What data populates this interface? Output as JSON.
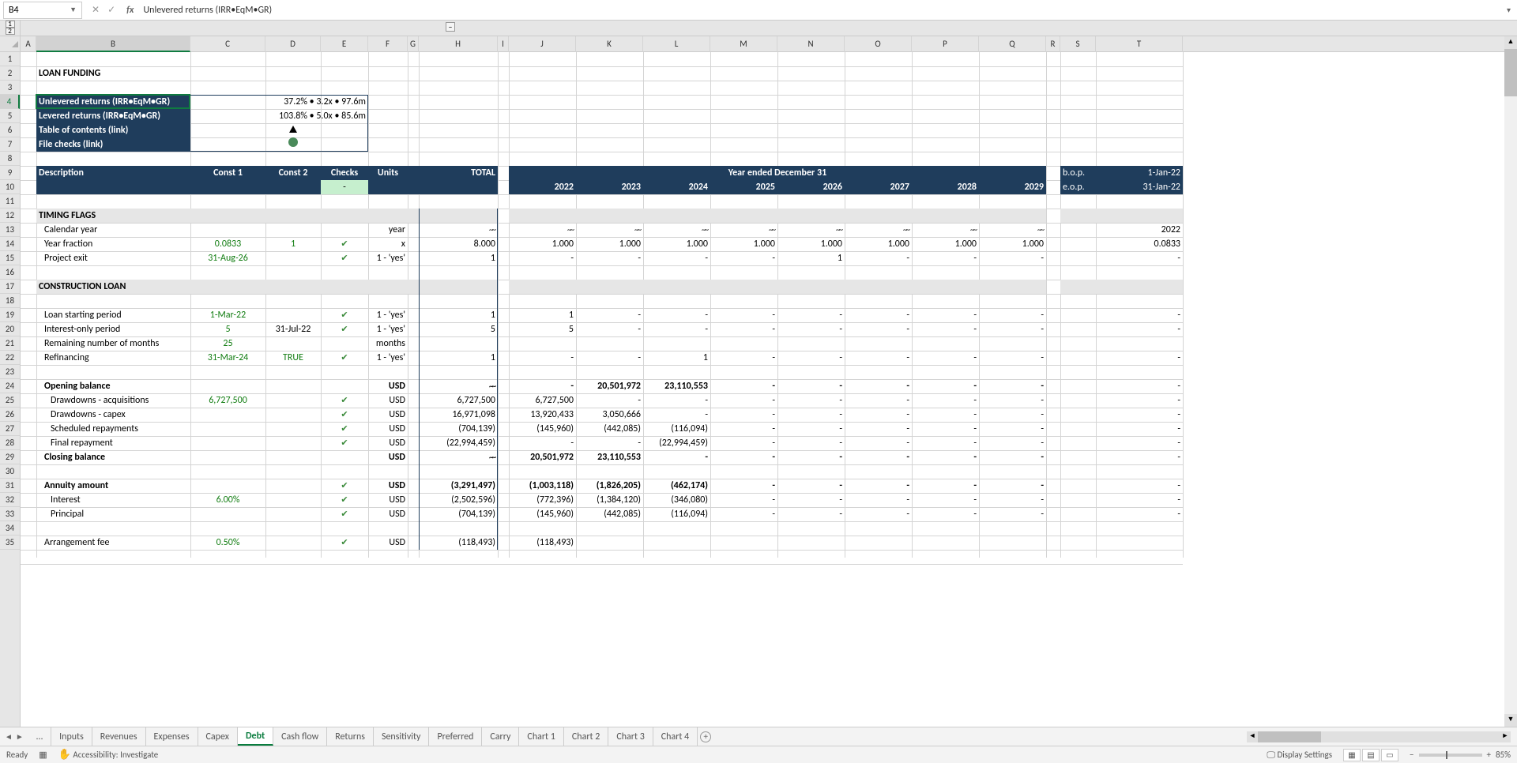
{
  "cellref": "B4",
  "formula": "Unlevered returns (IRR•EqM•GR)",
  "outline": {
    "lv1": "1",
    "lv2": "2",
    "minus": "–"
  },
  "cols": [
    "A",
    "B",
    "C",
    "D",
    "E",
    "F",
    "G",
    "H",
    "I",
    "J",
    "K",
    "L",
    "M",
    "N",
    "O",
    "P",
    "Q",
    "R",
    "S",
    "T"
  ],
  "rownums": [
    "1",
    "2",
    "3",
    "4",
    "5",
    "6",
    "7",
    "8",
    "9",
    "10",
    "11",
    "12",
    "13",
    "14",
    "15",
    "16",
    "17",
    "18",
    "19",
    "20",
    "21",
    "22",
    "23",
    "24",
    "25",
    "26",
    "27",
    "28",
    "29",
    "30",
    "31",
    "32",
    "33",
    "34",
    "35"
  ],
  "title": "LOAN FUNDING",
  "box": {
    "r4l": "Unlevered returns (IRR•EqM•GR)",
    "r4r": "37.2% • 3.2x • 97.6m",
    "r5l": "Levered returns (IRR•EqM•GR)",
    "r5r": "103.8% • 5.0x • 85.6m",
    "r6l": "Table of contents (link)",
    "r7l": "File checks (link)"
  },
  "hdr": {
    "desc": "Description",
    "c1": "Const 1",
    "c2": "Const 2",
    "chk": "Checks",
    "units": "Units",
    "total": "TOTAL",
    "yrs": "Year ended December 31",
    "bop": "b.o.p.",
    "bopv": "1-Jan-22",
    "eop": "e.o.p.",
    "eopv": "31-Jan-22",
    "y": [
      "2022",
      "2023",
      "2024",
      "2025",
      "2026",
      "2027",
      "2028",
      "2029"
    ],
    "dash": "-"
  },
  "s12": "TIMING FLAGS",
  "r13": {
    "b": "Calendar year",
    "f": "year",
    "h": "~~",
    "y": [
      "~~",
      "~~",
      "~~",
      "~~",
      "~~",
      "~~",
      "~~",
      "~~"
    ],
    "t": "2022"
  },
  "r14": {
    "b": "Year fraction",
    "c": "0.0833",
    "d": "1",
    "f": "x",
    "h": "8.000",
    "y": [
      "1.000",
      "1.000",
      "1.000",
      "1.000",
      "1.000",
      "1.000",
      "1.000",
      "1.000"
    ],
    "t": "0.0833"
  },
  "r15": {
    "b": "Project exit",
    "c": "31-Aug-26",
    "f": "1 - 'yes'",
    "h": "1",
    "y": [
      "-",
      "-",
      "-",
      "-",
      "1",
      "-",
      "-",
      "-"
    ],
    "t": "-"
  },
  "s17": "CONSTRUCTION LOAN",
  "r19": {
    "b": "Loan starting period",
    "c": "1-Mar-22",
    "f": "1 - 'yes'",
    "h": "1",
    "y": [
      "1",
      "-",
      "-",
      "-",
      "-",
      "-",
      "-",
      "-"
    ],
    "t": "-"
  },
  "r20": {
    "b": "Interest-only period",
    "c": "5",
    "d": "31-Jul-22",
    "f": "1 - 'yes'",
    "h": "5",
    "y": [
      "5",
      "-",
      "-",
      "-",
      "-",
      "-",
      "-",
      "-"
    ],
    "t": "-"
  },
  "r21": {
    "b": "Remaining number of months",
    "c": "25",
    "f": "months"
  },
  "r22": {
    "b": "Refinancing",
    "c": "31-Mar-24",
    "d": "TRUE",
    "f": "1 - 'yes'",
    "h": "1",
    "y": [
      "-",
      "-",
      "1",
      "-",
      "-",
      "-",
      "-",
      "-"
    ],
    "t": "-"
  },
  "r24": {
    "b": "Opening balance",
    "f": "USD",
    "h": "~~",
    "y": [
      "-",
      "20,501,972",
      "23,110,553",
      "-",
      "-",
      "-",
      "-",
      "-"
    ],
    "t": "-"
  },
  "r25": {
    "b": "Drawdowns - acquisitions",
    "c": "6,727,500",
    "f": "USD",
    "h": "6,727,500",
    "y": [
      "6,727,500",
      "-",
      "-",
      "-",
      "-",
      "-",
      "-",
      "-"
    ],
    "t": "-"
  },
  "r26": {
    "b": "Drawdowns - capex",
    "f": "USD",
    "h": "16,971,098",
    "y": [
      "13,920,433",
      "3,050,666",
      "-",
      "-",
      "-",
      "-",
      "-",
      "-"
    ],
    "t": "-"
  },
  "r27": {
    "b": "Scheduled repayments",
    "f": "USD",
    "h": "(704,139)",
    "y": [
      "(145,960)",
      "(442,085)",
      "(116,094)",
      "-",
      "-",
      "-",
      "-",
      "-"
    ],
    "t": "-"
  },
  "r28": {
    "b": "Final repayment",
    "f": "USD",
    "h": "(22,994,459)",
    "y": [
      "-",
      "-",
      "(22,994,459)",
      "-",
      "-",
      "-",
      "-",
      "-"
    ],
    "t": "-"
  },
  "r29": {
    "b": "Closing balance",
    "f": "USD",
    "h": "~~",
    "y": [
      "20,501,972",
      "23,110,553",
      "-",
      "-",
      "-",
      "-",
      "-",
      "-"
    ],
    "t": "-"
  },
  "r31": {
    "b": "Annuity amount",
    "f": "USD",
    "h": "(3,291,497)",
    "y": [
      "(1,003,118)",
      "(1,826,205)",
      "(462,174)",
      "-",
      "-",
      "-",
      "-",
      "-"
    ],
    "t": "-"
  },
  "r32": {
    "b": "Interest",
    "c": "6.00%",
    "f": "USD",
    "h": "(2,502,596)",
    "y": [
      "(772,396)",
      "(1,384,120)",
      "(346,080)",
      "-",
      "-",
      "-",
      "-",
      "-"
    ],
    "t": "-"
  },
  "r33": {
    "b": "Principal",
    "f": "USD",
    "h": "(704,139)",
    "y": [
      "(145,960)",
      "(442,085)",
      "(116,094)",
      "-",
      "-",
      "-",
      "-",
      "-"
    ],
    "t": "-"
  },
  "r35": {
    "b": "Arrangement fee",
    "c": "0.50%",
    "f": "USD",
    "h": "(118,493)",
    "j": "(118,493)"
  },
  "tabs": [
    "…",
    "Inputs",
    "Revenues",
    "Expenses",
    "Capex",
    "Debt",
    "Cash flow",
    "Returns",
    "Sensitivity",
    "Preferred",
    "Carry",
    "Chart 1",
    "Chart 2",
    "Chart 3",
    "Chart 4"
  ],
  "activeTab": "Debt",
  "status": {
    "ready": "Ready",
    "acc": "Accessibility: Investigate",
    "disp": "Display Settings",
    "zoom": "85%"
  }
}
